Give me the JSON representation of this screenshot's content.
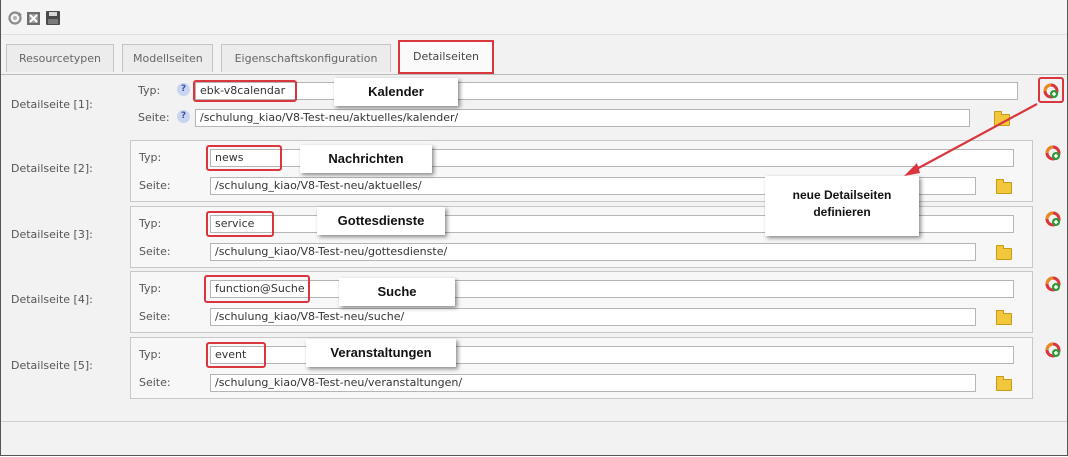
{
  "tabs": [
    {
      "label": "Resourcetypen",
      "active": false
    },
    {
      "label": "Modellseiten",
      "active": false
    },
    {
      "label": "Eigenschaftskonfiguration",
      "active": false
    },
    {
      "label": "Detailseiten",
      "active": true
    }
  ],
  "field_labels": {
    "typ": "Typ:",
    "seite": "Seite:"
  },
  "help_glyph": "?",
  "rows": [
    {
      "label": "Detailseite [1]:",
      "typ": "ebk-v8calendar",
      "seite": "/schulung_kiao/V8-Test-neu/aktuelles/kalender/",
      "callout": "Kalender"
    },
    {
      "label": "Detailseite [2]:",
      "typ": "news",
      "seite": "/schulung_kiao/V8-Test-neu/aktuelles/",
      "callout": "Nachrichten"
    },
    {
      "label": "Detailseite [3]:",
      "typ": "service",
      "seite": "/schulung_kiao/V8-Test-neu/gottesdienste/",
      "callout": "Gottesdienste"
    },
    {
      "label": "Detailseite [4]:",
      "typ": "function@Suche",
      "seite": "/schulung_kiao/V8-Test-neu/suche/",
      "callout": "Suche"
    },
    {
      "label": "Detailseite [5]:",
      "typ": "event",
      "seite": "/schulung_kiao/V8-Test-neu/veranstaltungen/",
      "callout": "Veranstaltungen"
    }
  ],
  "annotation": {
    "line1": "neue Detailseiten",
    "line2": "definieren"
  },
  "colors": {
    "highlight": "#d9363e",
    "folder": "#f3c73b"
  },
  "icons": {
    "toolbar": [
      "refresh-icon",
      "delete-icon",
      "save-icon"
    ],
    "row_action": "add-detail-page-icon",
    "seite_action": "folder-icon"
  }
}
